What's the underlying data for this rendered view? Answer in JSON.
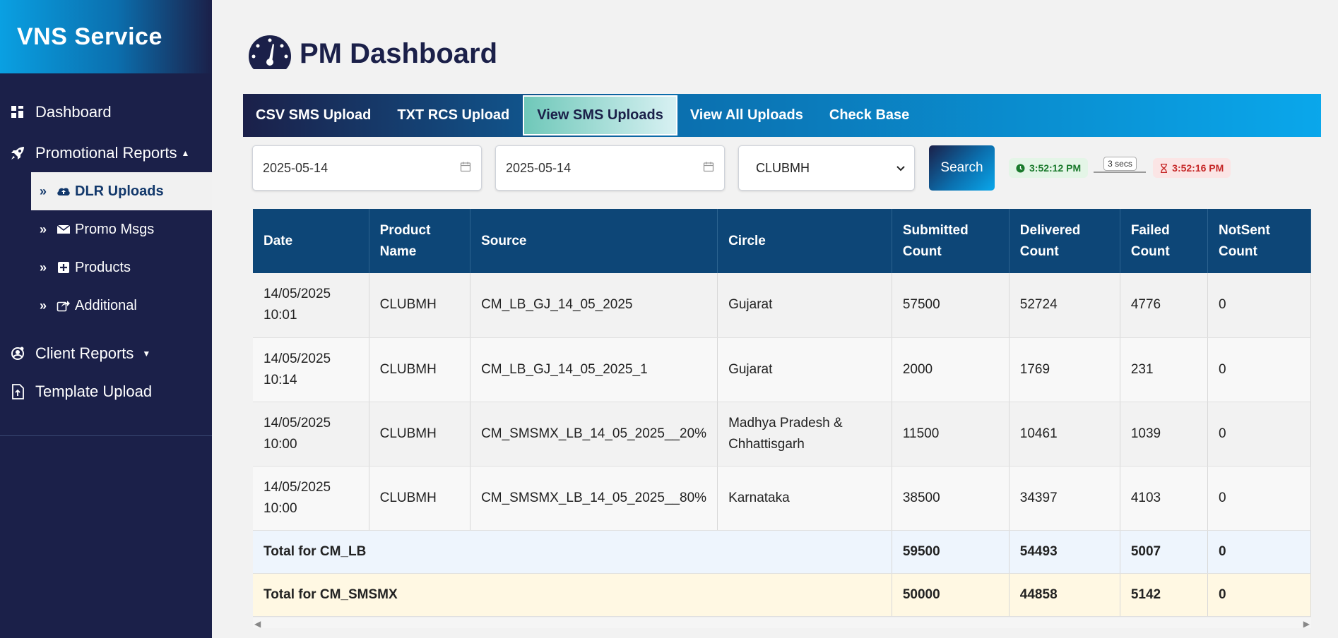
{
  "brand": "VNS Service",
  "sidebar": {
    "items": [
      {
        "label": "Dashboard",
        "icon": "dashboard-icon"
      },
      {
        "label": "Promotional Reports",
        "icon": "rocket-icon",
        "caret": "▲"
      },
      {
        "label": "Client Reports",
        "icon": "client-icon",
        "caret": "▼"
      },
      {
        "label": "Template Upload",
        "icon": "upload-icon"
      }
    ],
    "sub_items": [
      {
        "label": "DLR Uploads",
        "icon": "cloud-upload-icon",
        "active": true
      },
      {
        "label": "Promo Msgs",
        "icon": "envelope-icon"
      },
      {
        "label": "Products",
        "icon": "plus-square-icon"
      },
      {
        "label": "Additional",
        "icon": "share-square-icon"
      }
    ]
  },
  "page_title": "PM Dashboard",
  "tabs": [
    {
      "label": "CSV SMS Upload"
    },
    {
      "label": "TXT RCS Upload"
    },
    {
      "label": "View SMS Uploads",
      "active": true
    },
    {
      "label": "View All Uploads"
    },
    {
      "label": "Check Base"
    }
  ],
  "filters": {
    "from_date": "2025-05-14",
    "to_date": "2025-05-14",
    "product": "CLUBMH",
    "search_label": "Search"
  },
  "timer": {
    "start": "3:52:12 PM",
    "duration": "3 secs",
    "end": "3:52:16 PM"
  },
  "table": {
    "headers": [
      "Date",
      "Product Name",
      "Source",
      "Circle",
      "Submitted Count",
      "Delivered Count",
      "Failed Count",
      "NotSent Count"
    ],
    "rows": [
      {
        "date_line1": "14/05/2025",
        "date_line2": "10:01",
        "product": "CLUBMH",
        "source": "CM_LB_GJ_14_05_2025",
        "circle": "Gujarat",
        "submitted": "57500",
        "delivered": "52724",
        "failed": "4776",
        "notsent": "0"
      },
      {
        "date_line1": "14/05/2025",
        "date_line2": "10:14",
        "product": "CLUBMH",
        "source": "CM_LB_GJ_14_05_2025_1",
        "circle": "Gujarat",
        "submitted": "2000",
        "delivered": "1769",
        "failed": "231",
        "notsent": "0"
      },
      {
        "date_line1": "14/05/2025",
        "date_line2": "10:00",
        "product": "CLUBMH",
        "source": "CM_SMSMX_LB_14_05_2025__20%",
        "circle": "Madhya Pradesh & Chhattisgarh",
        "submitted": "11500",
        "delivered": "10461",
        "failed": "1039",
        "notsent": "0"
      },
      {
        "date_line1": "14/05/2025",
        "date_line2": "10:00",
        "product": "CLUBMH",
        "source": "CM_SMSMX_LB_14_05_2025__80%",
        "circle": "Karnataka",
        "submitted": "38500",
        "delivered": "34397",
        "failed": "4103",
        "notsent": "0"
      }
    ],
    "totals": [
      {
        "label": "Total for CM_LB",
        "submitted": "59500",
        "delivered": "54493",
        "failed": "5007",
        "notsent": "0"
      },
      {
        "label": "Total for CM_SMSMX",
        "submitted": "50000",
        "delivered": "44858",
        "failed": "5142",
        "notsent": "0"
      }
    ]
  }
}
